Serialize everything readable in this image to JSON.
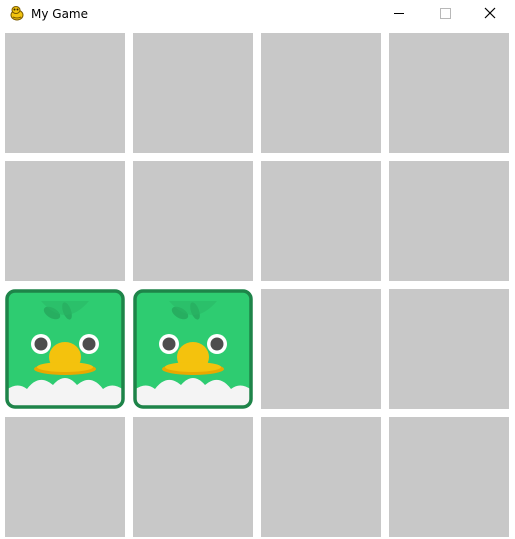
{
  "window": {
    "title": "My Game",
    "icon": "pygame-snake-icon",
    "controls": [
      "minimize-icon",
      "maximize-icon",
      "close-icon"
    ]
  },
  "board": {
    "rows": 4,
    "cols": 4,
    "hidden_color": "#c8c8c8",
    "background_color": "#ffffff",
    "tiles": [
      [
        "hidden",
        "hidden",
        "hidden",
        "hidden"
      ],
      [
        "hidden",
        "hidden",
        "hidden",
        "hidden"
      ],
      [
        "bird",
        "bird",
        "hidden",
        "hidden"
      ],
      [
        "hidden",
        "hidden",
        "hidden",
        "hidden"
      ]
    ]
  },
  "card_face": {
    "name": "green-bird",
    "body_color": "#2ecc71",
    "border_color": "#1e8449",
    "beak_color": "#f4c20d",
    "belly_color": "#f4f4f4"
  }
}
